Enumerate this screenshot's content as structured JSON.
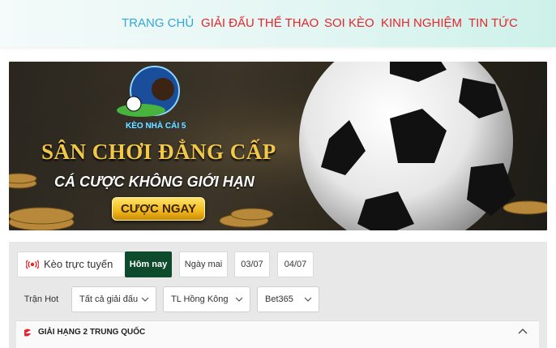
{
  "nav": {
    "items": [
      {
        "label": "TRANG CHỦ",
        "active": true
      },
      {
        "label": "GIẢI ĐẤU THỂ THAO",
        "active": false
      },
      {
        "label": "SOI KÈO",
        "active": false
      },
      {
        "label": "KINH NGHIỆM",
        "active": false
      },
      {
        "label": "TIN TỨC",
        "active": false
      }
    ]
  },
  "banner": {
    "logo_text": "KÈO NHÀ CÁI 5",
    "headline": "SÂN CHƠI ĐẲNG CẤP",
    "subheadline": "CÁ CƯỢC KHÔNG GIỚI HẠN",
    "cta": "CƯỢC NGAY"
  },
  "filters": {
    "live_label": "Kèo trực tuyến",
    "days": [
      "Hôm nay",
      "Ngày mai",
      "03/07",
      "04/07"
    ],
    "active_day": "Hôm nay",
    "hot_label": "Trận Hot",
    "league_select": "Tất cả giải đấu",
    "odds_type_select": "TL Hồng Kông",
    "bookmaker_select": "Bet365"
  },
  "league": {
    "name": "GIẢI HẠNG 2 TRUNG QUỐC"
  },
  "colors": {
    "nav_active": "#33a7d6",
    "nav_default": "#e8242c",
    "primary_button": "#0e4b2c",
    "cta_gold": "#f2b81b"
  }
}
